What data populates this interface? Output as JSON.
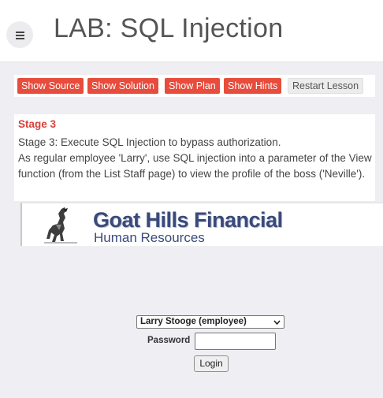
{
  "header": {
    "title": "LAB: SQL Injection",
    "menu_icon": "hamburger-icon"
  },
  "toolbar": {
    "buttons": [
      {
        "label": "Show Source"
      },
      {
        "label": "Show Solution"
      },
      {
        "label": "Show Plan"
      },
      {
        "label": "Show Hints"
      },
      {
        "label": "Restart Lesson"
      }
    ]
  },
  "stage": {
    "title": "Stage 3",
    "line1": "Stage 3: Execute SQL Injection to bypass authorization.",
    "line2": "As regular employee 'Larry', use SQL injection into a parameter of the View function (from the List Staff page) to view the profile of the boss ('Neville')."
  },
  "lesson": {
    "company": "Goat Hills Financial",
    "department": "Human Resources",
    "employee_selected": "Larry Stooge (employee)",
    "password_label": "Password",
    "password_value": "",
    "login_label": "Login"
  },
  "colors": {
    "accent": "#e74c3c",
    "brand": "#3a4a7a"
  }
}
